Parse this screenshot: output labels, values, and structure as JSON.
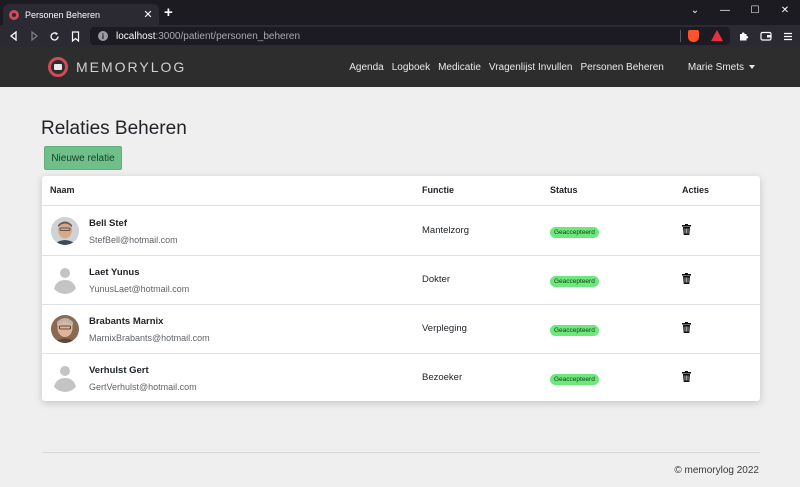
{
  "browser": {
    "tab_title": "Personen Beheren",
    "tab_close": "✕",
    "new_tab": "+",
    "url_host": "localhost",
    "url_path": ":3000/patient/personen_beheren",
    "window_controls": [
      "⌄",
      "—",
      "☐",
      "✕"
    ]
  },
  "navbar": {
    "logo_text": "MEMORYLOG",
    "links": [
      "Agenda",
      "Logboek",
      "Medicatie",
      "Vragenlijst Invullen",
      "Personen Beheren"
    ],
    "user": "Marie Smets"
  },
  "page": {
    "title": "Relaties Beheren",
    "new_button": "Nieuwe relatie"
  },
  "table": {
    "headers": {
      "naam": "Naam",
      "functie": "Functie",
      "status": "Status",
      "acties": "Acties"
    },
    "rows": [
      {
        "name": "Bell Stef",
        "email": "StefBell@hotmail.com",
        "functie": "Mantelzorg",
        "status": "Geaccepteerd",
        "avatar": "photo"
      },
      {
        "name": "Laet Yunus",
        "email": "YunusLaet@hotmail.com",
        "functie": "Dokter",
        "status": "Geaccepteerd",
        "avatar": "placeholder"
      },
      {
        "name": "Brabants Marnix",
        "email": "MarnixBrabants@hotmail.com",
        "functie": "Verpleging",
        "status": "Geaccepteerd",
        "avatar": "photo"
      },
      {
        "name": "Verhulst Gert",
        "email": "GertVerhulst@hotmail.com",
        "functie": "Bezoeker",
        "status": "Geaccepteerd",
        "avatar": "placeholder"
      }
    ]
  },
  "footer": {
    "text": "© memorylog 2022"
  },
  "colors": {
    "brand": "#d24a5a",
    "navbar_bg": "#2d2d2d",
    "button_green": "#6fbf8b",
    "badge_green": "#6ee77c",
    "page_bg": "#efefef"
  },
  "icons": {
    "row_action": "trash-icon",
    "placeholder_avatar": "user-silhouette-icon"
  }
}
